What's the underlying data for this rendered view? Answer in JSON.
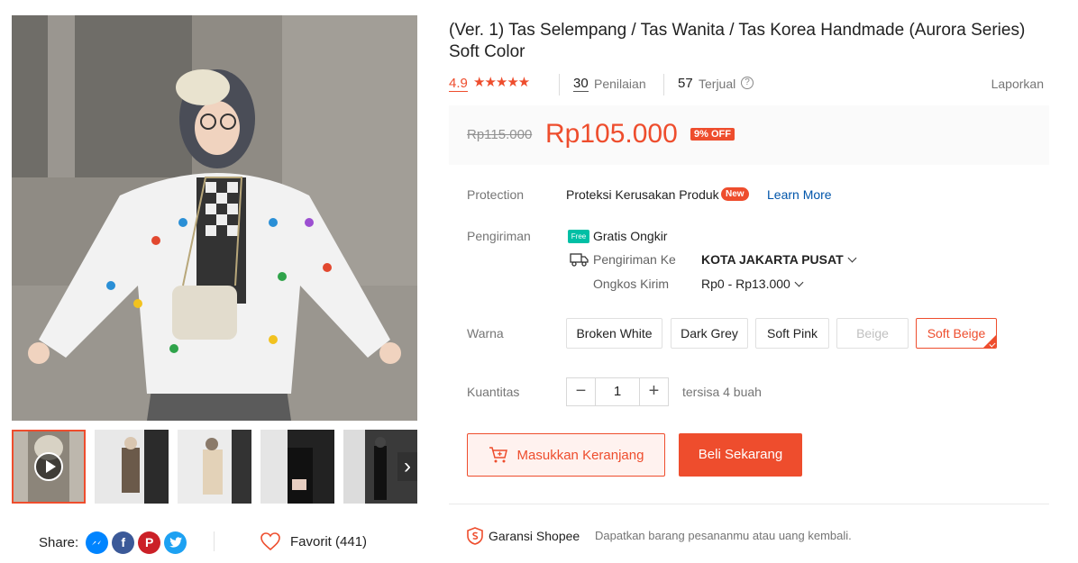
{
  "product": {
    "title": "(Ver. 1) Tas Selempang / Tas Wanita / Tas Korea Handmade (Aurora Series) Soft Color",
    "rating": "4.9",
    "stars": "★★★★★",
    "reviews_count": "30",
    "reviews_label": "Penilaian",
    "sold_count": "57",
    "sold_label": "Terjual",
    "report_label": "Laporkan"
  },
  "price": {
    "original": "Rp115.000",
    "current": "Rp105.000",
    "discount": "9% OFF"
  },
  "protection": {
    "label": "Protection",
    "text": "Proteksi Kerusakan Produk",
    "badge": "New",
    "link": "Learn More"
  },
  "shipping": {
    "label": "Pengiriman",
    "free_badge": "Free",
    "free_text": "Gratis Ongkir",
    "to_label": "Pengiriman Ke",
    "city": "KOTA JAKARTA PUSAT",
    "cost_label": "Ongkos Kirim",
    "cost": "Rp0 - Rp13.000"
  },
  "variants": {
    "label": "Warna",
    "options": [
      "Broken White",
      "Dark Grey",
      "Soft Pink",
      "Beige",
      "Soft Beige"
    ],
    "disabled": "Beige",
    "selected": "Soft Beige"
  },
  "quantity": {
    "label": "Kuantitas",
    "value": "1",
    "stock": "tersisa 4 buah"
  },
  "actions": {
    "add_to_cart": "Masukkan Keranjang",
    "buy_now": "Beli Sekarang"
  },
  "share": {
    "label": "Share:",
    "favorite": "Favorit (441)"
  },
  "guarantee": {
    "title": "Garansi Shopee",
    "text": "Dapatkan barang pesananmu atau uang kembali."
  },
  "colors": {
    "accent": "#ee4d2d",
    "link": "#0055aa",
    "messenger": "#0084ff",
    "facebook": "#3b5998",
    "pinterest": "#cb2027",
    "twitter": "#1da1f2"
  },
  "icons": {
    "social": [
      "messenger-icon",
      "facebook-icon",
      "pinterest-icon",
      "twitter-icon"
    ]
  }
}
